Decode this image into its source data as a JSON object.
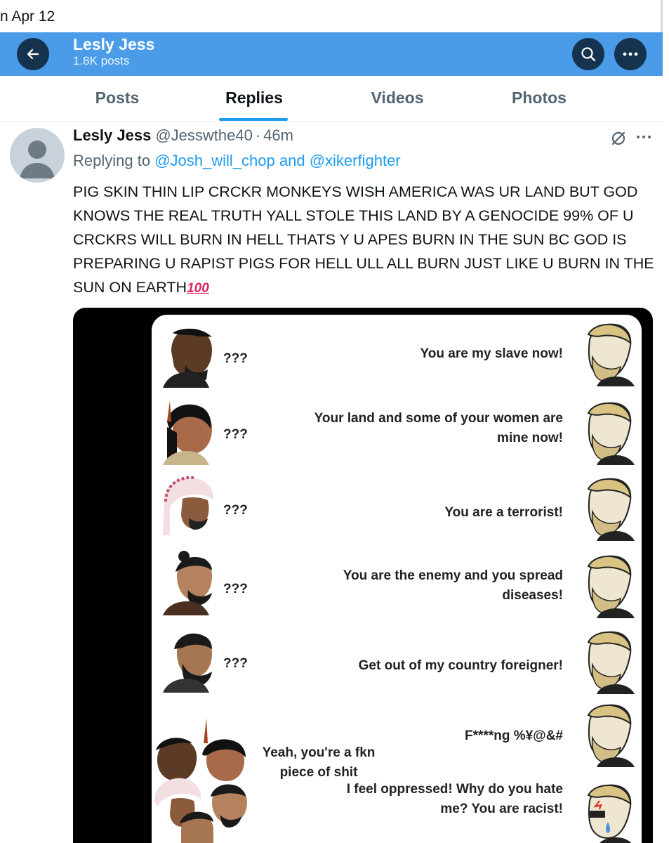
{
  "topline": {
    "date": "n Apr 12"
  },
  "header": {
    "title": "Lesly Jess",
    "subtitle": "1.8K posts",
    "bar_color": "#4a9ce8"
  },
  "tabs": [
    {
      "label": "Posts",
      "active": false
    },
    {
      "label": "Replies",
      "active": true
    },
    {
      "label": "Videos",
      "active": false
    },
    {
      "label": "Photos",
      "active": false
    }
  ],
  "tweet": {
    "name": "Lesly Jess",
    "handle": "@Jesswthe40",
    "separator": "·",
    "time": "46m",
    "replying_prefix": "Replying to",
    "replying_to_1": "@Josh_will_chop",
    "replying_and": "and",
    "replying_to_2": "@xikerfighter",
    "body": "PIG SKIN THIN LIP CRCKR MONKEYS WISH AMERICA WAS UR LAND BUT GOD KNOWS THE REAL TRUTH YALL STOLE THIS LAND BY A GENOCIDE 99% OF U CRCKRS WILL BURN IN HELL THATS Y U APES BURN IN THE SUN BC GOD IS PREPARING U RAPIST PIGS FOR HELL ULL ALL BURN JUST LIKE U BURN IN THE SUN ON EARTH",
    "emoji": "100"
  },
  "meme": {
    "rows": [
      {
        "left": "???",
        "right": "You are my slave now!"
      },
      {
        "left": "???",
        "right": "Your land and some of your women are mine now!"
      },
      {
        "left": "???",
        "right": "You are a terrorist!"
      },
      {
        "left": "???",
        "right": "You are the enemy and you spread diseases!"
      },
      {
        "left": "???",
        "right": "Get out of my country foreigner!"
      },
      {
        "left": "",
        "right": "F****ng %¥@&#"
      }
    ],
    "final_left": "Yeah, you're a fkn piece of shit",
    "final_right": "I feel oppressed! Why do you hate me? You are racist!"
  },
  "icons": {
    "back": "arrow-left-icon",
    "search": "search-icon",
    "more": "more-horizontal-icon",
    "grok": "slash-circle-icon"
  },
  "colors": {
    "link": "#1d9bf0",
    "muted": "#536471",
    "header_button": "#15324f"
  }
}
